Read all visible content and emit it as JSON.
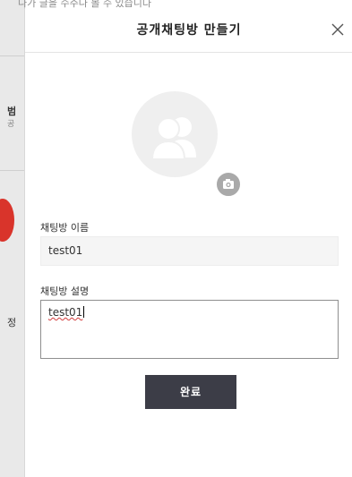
{
  "background": {
    "top_text": "나가 글을 수주나 볼 수 있습니다",
    "side_glyphs": [
      "범",
      "공",
      "정"
    ]
  },
  "modal": {
    "title": "공개채팅방 만들기",
    "close_icon": "close-icon",
    "avatar_icon": "group-users-icon",
    "camera_icon": "camera-icon"
  },
  "form": {
    "name_label": "채팅방 이름",
    "name_value": "test01",
    "description_label": "채팅방 설명",
    "description_value": "test01"
  },
  "actions": {
    "done_label": "완료"
  },
  "colors": {
    "button_bg": "#3c3d47",
    "avatar_bg": "#efefef",
    "camera_bg": "#a9a9a9",
    "input_bg": "#f5f5f5"
  }
}
